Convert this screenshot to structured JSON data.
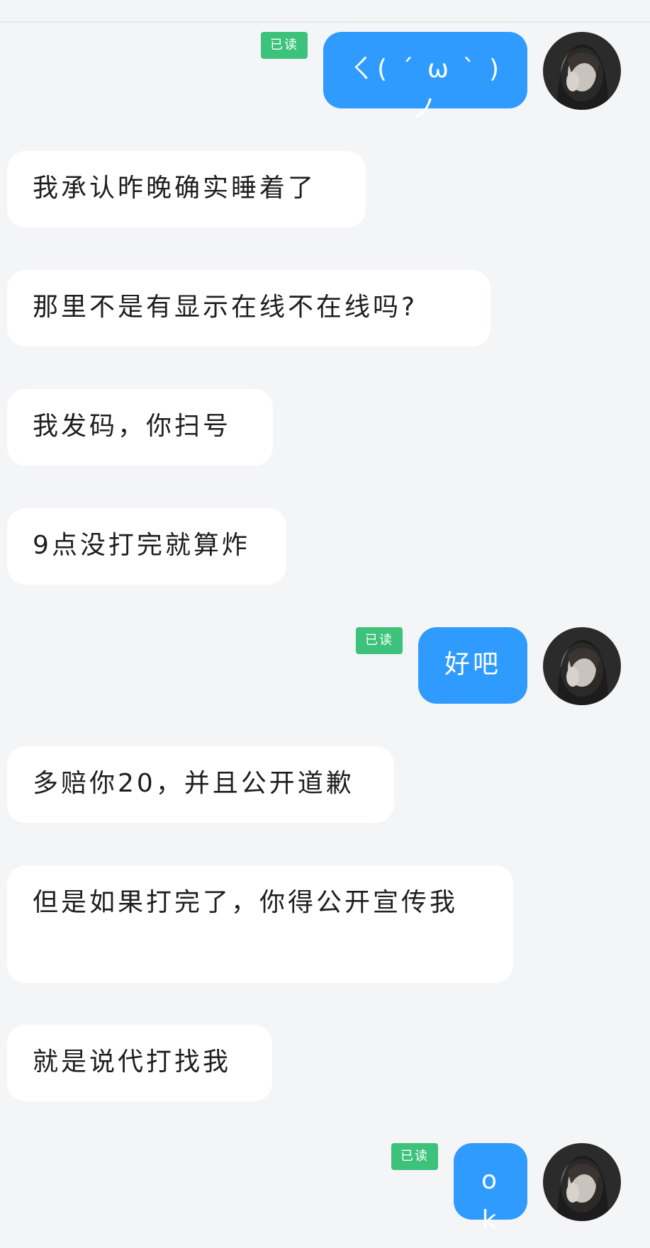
{
  "theme": {
    "background": "#f4f5f7",
    "incoming_bubble": "#ffffff",
    "outgoing_bubble": "#2f9bff",
    "read_badge": "#3cc27a"
  },
  "read_label": "已读",
  "messages": [
    {
      "side": "outgoing",
      "text": "ㄑ( ˊ ω ˋ )ノ",
      "read": true,
      "avatar": "user-avatar-icon"
    },
    {
      "side": "incoming",
      "text": "我承认昨晚确实睡着了"
    },
    {
      "side": "incoming",
      "text": "那里不是有显示在线不在线吗?"
    },
    {
      "side": "incoming",
      "text": "我发码，你扫号"
    },
    {
      "side": "incoming",
      "text": "9点没打完就算炸"
    },
    {
      "side": "outgoing",
      "text": "好吧",
      "read": true,
      "avatar": "user-avatar-icon"
    },
    {
      "side": "incoming",
      "text": "多赔你20，并且公开道歉"
    },
    {
      "side": "incoming",
      "text": "但是如果打完了，你得公开宣传我"
    },
    {
      "side": "incoming",
      "text": "就是说代打找我"
    },
    {
      "side": "outgoing",
      "text": "ok",
      "read": true,
      "avatar": "user-avatar-icon"
    }
  ]
}
